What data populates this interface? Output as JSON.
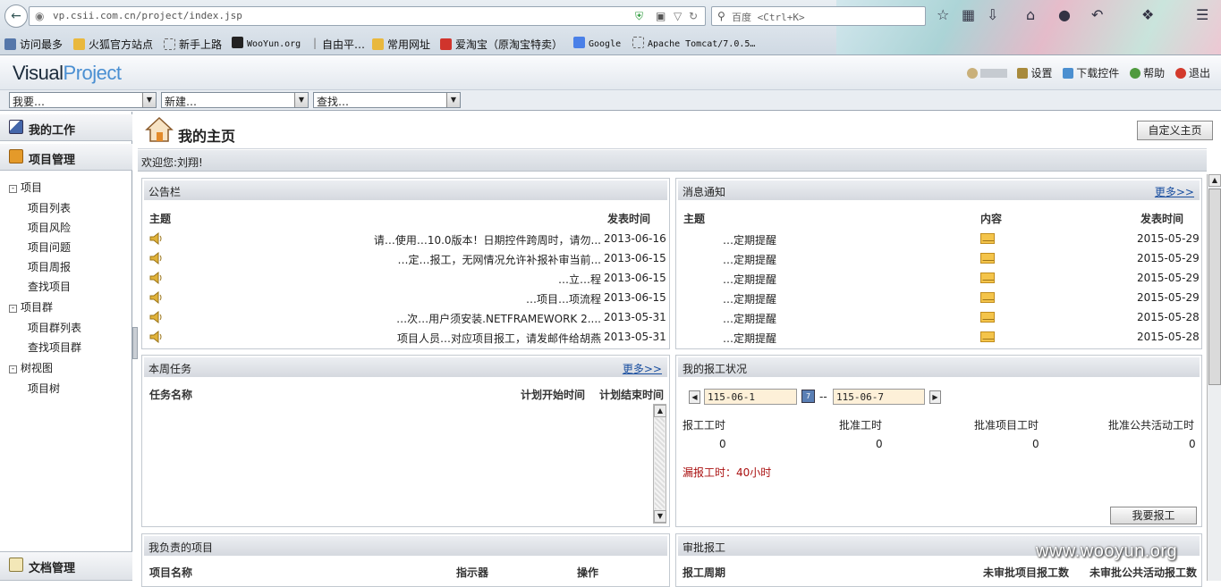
{
  "browser": {
    "url": "vp.csii.com.cn/project/index.jsp",
    "search_placeholder": "百度 <Ctrl+K>",
    "bookmarks": [
      "访问最多",
      "火狐官方站点",
      "新手上路",
      "WooYun.org",
      "自由平…",
      "常用网址",
      "爱淘宝（原淘宝特卖）",
      "Google",
      "Apache Tomcat/7.0.5…"
    ]
  },
  "app": {
    "logo_a": "Visual",
    "logo_b": "Project",
    "top_links": [
      "设置",
      "下载控件",
      "帮助",
      "退出"
    ],
    "selects": [
      "我要…",
      "新建…",
      "查找…"
    ]
  },
  "sidebar": {
    "my_work": "我的工作",
    "project_mgmt": "项目管理",
    "doc_mgmt": "文档管理",
    "groups": [
      {
        "label": "项目",
        "items": [
          "项目列表",
          "项目风险",
          "项目问题",
          "项目周报",
          "查找项目"
        ]
      },
      {
        "label": "项目群",
        "items": [
          "项目群列表",
          "查找项目群"
        ]
      },
      {
        "label": "树视图",
        "items": [
          "项目树"
        ]
      }
    ]
  },
  "main": {
    "title": "我的主页",
    "custom_button": "自定义主页",
    "welcome": "欢迎您:刘翔!"
  },
  "bulletin": {
    "title": "公告栏",
    "col_subject": "主题",
    "col_date": "发表时间",
    "rows": [
      {
        "text": "请…使用…10.0版本！日期控件跨周时，请勿...",
        "date": "2013-06-16"
      },
      {
        "text": "…定…报工，无网情况允许补报补审当前...",
        "date": "2013-06-15"
      },
      {
        "text": "…立…程",
        "date": "2013-06-15"
      },
      {
        "text": "…项目…项流程",
        "date": "2013-06-15"
      },
      {
        "text": "…次…用户须安装.NETFRAMEWORK 2....",
        "date": "2013-05-31"
      },
      {
        "text": "项目人员…对应项目报工，请发邮件给胡燕",
        "date": "2013-05-31"
      }
    ]
  },
  "messages": {
    "title": "消息通知",
    "more": "更多>>",
    "col_subject": "主题",
    "col_content": "内容",
    "col_date": "发表时间",
    "rows": [
      {
        "text": "…定期提醒",
        "date": "2015-05-29"
      },
      {
        "text": "…定期提醒",
        "date": "2015-05-29"
      },
      {
        "text": "…定期提醒",
        "date": "2015-05-29"
      },
      {
        "text": "…定期提醒",
        "date": "2015-05-29"
      },
      {
        "text": "…定期提醒",
        "date": "2015-05-28"
      },
      {
        "text": "…定期提醒",
        "date": "2015-05-28"
      }
    ]
  },
  "weekly_tasks": {
    "title": "本周任务",
    "more": "更多>>",
    "col_name": "任务名称",
    "col_start": "计划开始时间",
    "col_end": "计划结束时间"
  },
  "my_report": {
    "title": "我的报工状况",
    "date_from": "115-06-1",
    "date_sep": "--",
    "date_to": "115-06-7",
    "labels": [
      "报工工时",
      "批准工时",
      "批准项目工时",
      "批准公共活动工时"
    ],
    "values": [
      "0",
      "0",
      "0",
      "0"
    ],
    "missing": "漏报工时：40小时",
    "button": "我要报工"
  },
  "my_projects": {
    "title": "我负责的项目",
    "col_name": "项目名称",
    "col_indicator": "指示器",
    "col_action": "操作"
  },
  "approval": {
    "title": "审批报工",
    "col_period": "报工周期",
    "col_unapproved_proj": "未审批项目报工数",
    "col_unapproved_public": "未审批公共活动报工数"
  },
  "watermark": "www.wooyun.org"
}
